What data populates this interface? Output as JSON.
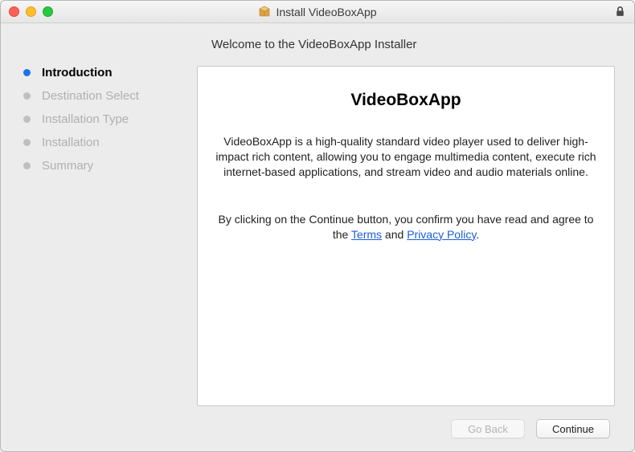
{
  "window": {
    "title": "Install VideoBoxApp"
  },
  "heading": "Welcome to the VideoBoxApp Installer",
  "sidebar": {
    "steps": [
      {
        "label": "Introduction",
        "active": true
      },
      {
        "label": "Destination Select",
        "active": false
      },
      {
        "label": "Installation Type",
        "active": false
      },
      {
        "label": "Installation",
        "active": false
      },
      {
        "label": "Summary",
        "active": false
      }
    ]
  },
  "panel": {
    "title": "VideoBoxApp",
    "description": "VideoBoxApp is a high-quality standard video player used to deliver high-impact rich content, allowing you to engage multimedia content, execute rich internet-based applications, and stream video and audio materials online.",
    "agree_prefix": "By clicking on the Continue button, you confirm you have read and agree to the ",
    "terms_label": "Terms",
    "and_label": " and ",
    "privacy_label": "Privacy Policy",
    "agree_suffix": "."
  },
  "buttons": {
    "go_back": "Go Back",
    "continue": "Continue"
  }
}
